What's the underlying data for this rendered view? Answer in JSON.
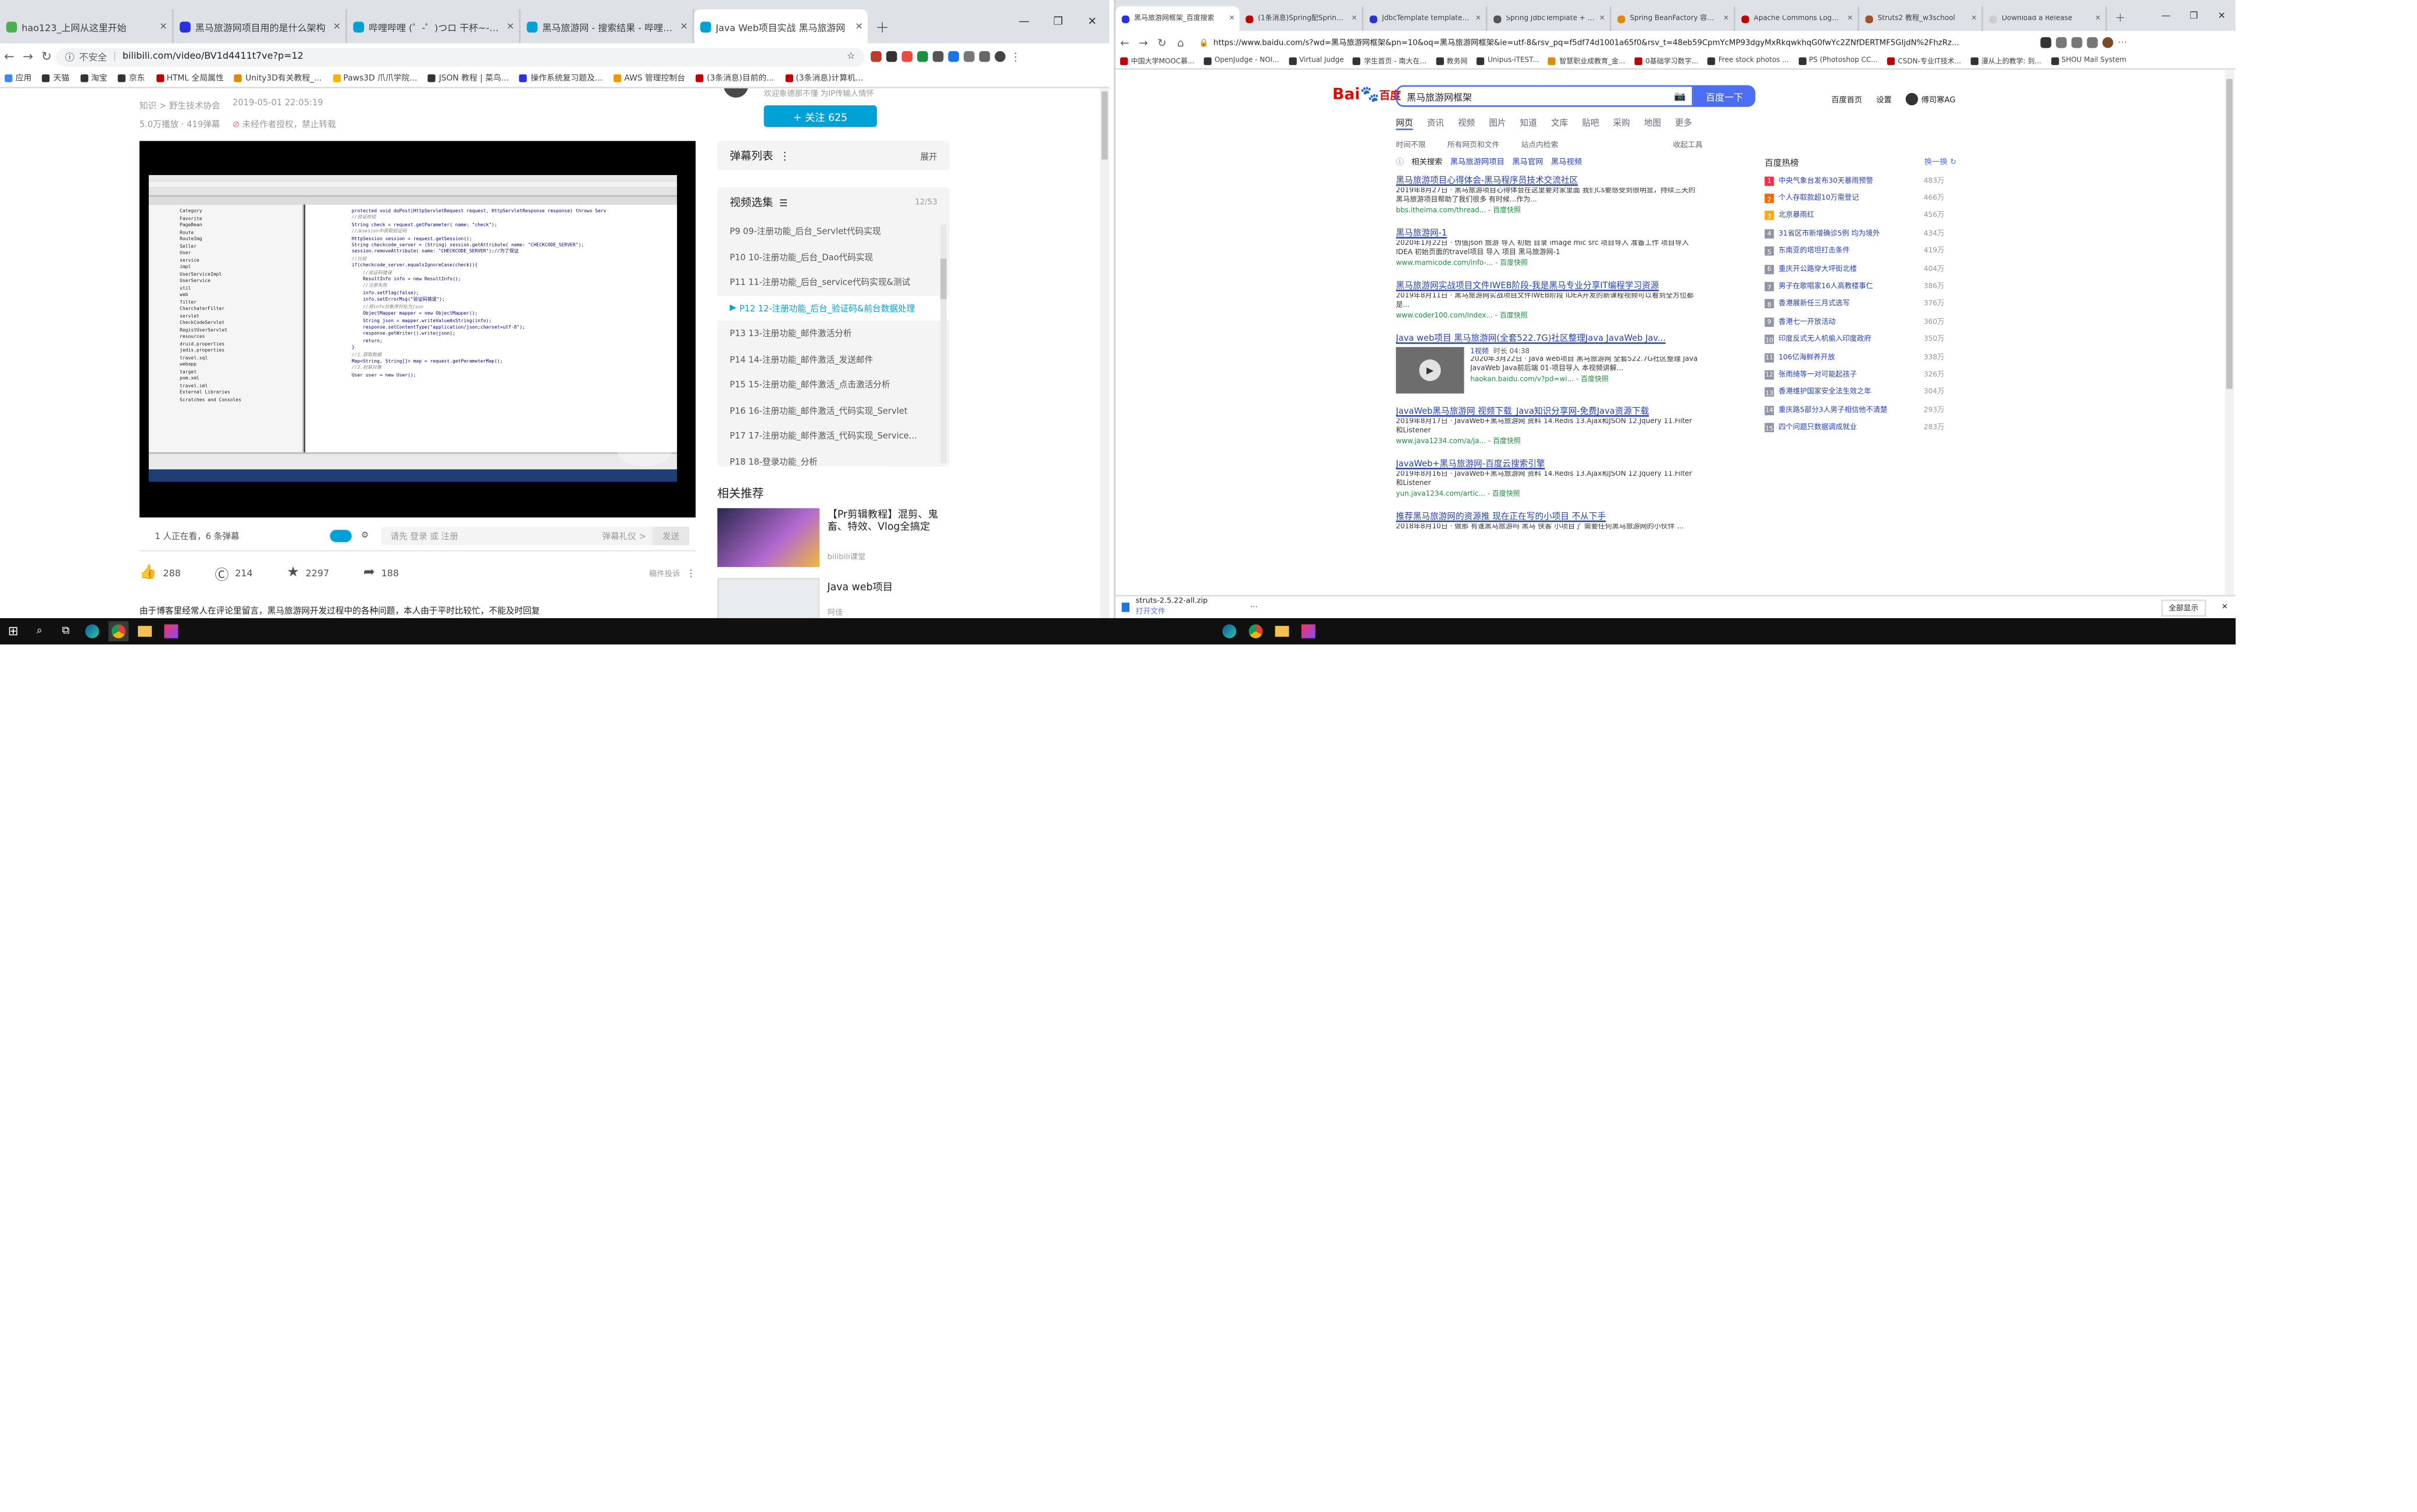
{
  "left_browser": {
    "tabs": [
      {
        "title": "hao123_上网从这里开始",
        "icon_color": "#4caf50"
      },
      {
        "title": "黑马旅游网项目用的是什么架构",
        "icon_color": "#2932e1"
      },
      {
        "title": "哔哩哔哩 (゜-゜)つロ 干杯~-bili",
        "icon_color": "#00a1d6"
      },
      {
        "title": "黑马旅游网 - 搜索结果 - 哔哩哔哩",
        "icon_color": "#00a1d6"
      },
      {
        "title": "Java Web项目实战 黑马旅游网",
        "icon_color": "#00a1d6"
      }
    ],
    "url_security": "不安全",
    "url": "bilibili.com/video/BV1d4411t7ve?p=12",
    "bookmarks": [
      {
        "label": "应用",
        "color": "#4285f4"
      },
      {
        "label": "天猫",
        "color": "#333333"
      },
      {
        "label": "淘宝",
        "color": "#333333"
      },
      {
        "label": "京东",
        "color": "#333333"
      },
      {
        "label": "HTML 全局属性",
        "color": "#c00000"
      },
      {
        "label": "Unity3D有关教程_...",
        "color": "#e08a00"
      },
      {
        "label": "Paws3D 爪爪学院...",
        "color": "#f4b400"
      },
      {
        "label": "JSON 教程 | 菜鸟...",
        "color": "#333333"
      },
      {
        "label": "操作系统复习题及...",
        "color": "#2932e1"
      },
      {
        "label": "AWS 管理控制台",
        "color": "#f79400"
      },
      {
        "label": "(3条消息)目前的...",
        "color": "#c00000"
      },
      {
        "label": "(3条消息)计算机...",
        "color": "#c00000"
      }
    ],
    "page": {
      "breadcrumb": "知识 > 野生技术协会",
      "date": "2019-05-01 22:05:19",
      "views": "5.0万播放 · 419弹幕",
      "warning": "未经作者授权，禁止转载",
      "uploader_desc": "欢迎象德那不懂 为IP传输人情怀",
      "follow_label": "+ 关注 625",
      "danmaku_list": "弹幕列表",
      "danmaku_expand": "展开",
      "playlist_title": "视频选集",
      "playlist_count": "12/53",
      "playlist": [
        {
          "label": "P9  09-注册功能_后台_Servlet代码实现",
          "active": false
        },
        {
          "label": "P10  10-注册功能_后台_Dao代码实现",
          "active": false
        },
        {
          "label": "P11  11-注册功能_后台_service代码实现&测试",
          "active": false
        },
        {
          "label": "P12  12-注册功能_后台_验证码&前台数据处理",
          "active": true
        },
        {
          "label": "P13  13-注册功能_邮件激活分析",
          "active": false
        },
        {
          "label": "P14  14-注册功能_邮件激活_发送邮件",
          "active": false
        },
        {
          "label": "P15  15-注册功能_邮件激活_点击激活分析",
          "active": false
        },
        {
          "label": "P16  16-注册功能_邮件激活_代码实现_Servlet",
          "active": false
        },
        {
          "label": "P17  17-注册功能_邮件激活_代码实现_Service...",
          "active": false
        },
        {
          "label": "P18  18-登录功能_分析",
          "active": false
        }
      ],
      "related_title": "相关推荐",
      "related": [
        {
          "title": "【Pr剪辑教程】混剪、鬼畜、特效、Vlog全搞定",
          "author": "bilibili课堂"
        },
        {
          "title": "Java web项目",
          "author": "阿佳"
        }
      ],
      "viewer_line": "1 人正在看，6 条弹幕",
      "danmaku_prompt": "请先 登录 或 注册",
      "danmaku_etiquette": "弹幕礼仪 >",
      "send_label": "发送",
      "likes": "288",
      "coins": "214",
      "favorites": "2297",
      "shares": "188",
      "report": "稿件投诉",
      "desc": "由于博客里经常人在评论里留言，黑马旅游网开发过程中的各种问题，本人由于平时比较忙，不能及时回复",
      "code_lines": [
        "protected void doPost(HttpServletRequest request, HttpServletResponse response) throws Serv",
        "//验证校验",
        "String check = request.getParameter( name: \"check\");",
        "//从sesion中获取验证码",
        "HttpSession session = request.getSession();",
        "String checkcode_server = (String) session.getAttribute( name: \"CHECKCODE_SERVER\");",
        "session.removeAttribute( name: \"CHECKCODE_SERVER\");//为了保证",
        "//比较",
        "if(checkcode_server.equalsIgnoreCase(check)){",
        "    //验证码错误",
        "    ResultInfo info = new ResultInfo();",
        "    //注册失败",
        "    info.setFlag(false);",
        "    info.setErrorMsg(\"验证码错误\");",
        "    //将info对象序列化为json",
        "    ObjectMapper mapper = new ObjectMapper();",
        "    String json = mapper.writeValueAsString(info);",
        "    response.setContentType(\"application/json;charset=utf-8\");",
        "    response.getWriter().write(json);",
        "    return;",
        "}",
        "",
        "//1.获取数据",
        "Map<String, String[]> map = request.getParameterMap();",
        "",
        "//2.封装对象",
        "User user = new User();"
      ],
      "tree_items": [
        "Category",
        "Favorite",
        "PageBean",
        "Route",
        "RouteImg",
        "Seller",
        "User",
        "service",
        "impl",
        "UserServiceImpl",
        "UserService",
        "util",
        "web",
        "filter",
        "CharchaterFilter",
        "servlet",
        "CheckCodeServlet",
        "RegistUserServlet",
        "resources",
        "druid.properties",
        "jedis.properties",
        "travel.sql",
        "webapp",
        "target",
        "pom.xml",
        "travel.iml",
        "External Libraries",
        "Scratches and Consoles"
      ]
    }
  },
  "right_browser": {
    "tabs": [
      {
        "title": "黑马旅游网框架_百度搜索",
        "icon_color": "#2932e1"
      },
      {
        "title": "(1条消息)Spring配Spring框...",
        "icon_color": "#c00000"
      },
      {
        "title": "JdbcTemplate template_百...",
        "icon_color": "#2932e1"
      },
      {
        "title": "Spring JdbcTemplate + bo...",
        "icon_color": "#555555"
      },
      {
        "title": "Spring BeanFactory 容器_...",
        "icon_color": "#e08a00"
      },
      {
        "title": "Apache Commons Loggin...",
        "icon_color": "#c00000"
      },
      {
        "title": "Struts2 教程_w3school",
        "icon_color": "#a0522d"
      },
      {
        "title": "Download a Release",
        "icon_color": "#cccccc"
      }
    ],
    "url": "https://www.baidu.com/s?wd=黑马旅游网框架&pn=10&oq=黑马旅游网框架&ie=utf-8&rsv_pq=f5df74d1001a65f0&rsv_t=48eb59CpmYcMP93dgyMxRkqwkhqG0fwYc2ZNfDERTMF5GIjdN%2FhzRz...",
    "bookmarks": [
      {
        "label": "中国大学MOOC慕...",
        "color": "#c00000"
      },
      {
        "label": "OpenJudge - NOI...",
        "color": "#333333"
      },
      {
        "label": "Virtual Judge",
        "color": "#333333"
      },
      {
        "label": "学生首页 - 南大在...",
        "color": "#333333"
      },
      {
        "label": "教务网",
        "color": "#333333"
      },
      {
        "label": "Unipus-iTEST...",
        "color": "#333333"
      },
      {
        "label": "智慧职业成教育_金...",
        "color": "#e08a00"
      },
      {
        "label": "0基础学习数字...",
        "color": "#c00000"
      },
      {
        "label": "Free stock photos ...",
        "color": "#333333"
      },
      {
        "label": "PS (Photoshop CC...",
        "color": "#333333"
      },
      {
        "label": "CSDN-专业IT技术...",
        "color": "#c00000"
      },
      {
        "label": "漫从上的教学: 到...",
        "color": "#333333"
      },
      {
        "label": "SHOU Mail System",
        "color": "#333333"
      }
    ],
    "search_query": "黑马旅游网框架",
    "search_button": "百度一下",
    "header_links": [
      "百度首页",
      "设置"
    ],
    "user_name": "傅司寒AG",
    "nav_tabs": [
      "网页",
      "资讯",
      "视频",
      "图片",
      "知道",
      "文库",
      "贴吧",
      "采购",
      "地图",
      "更多"
    ],
    "tools": [
      "时间不限",
      "所有网页和文件",
      "站点内检索"
    ],
    "tools_right": "收起工具",
    "related_hint": "相关搜索",
    "related_links": [
      "黑马旅游网项目",
      "黑马官网",
      "黑马视频"
    ],
    "results": [
      {
        "title": "黑马旅游项目心得体会-黑马程序员技术交流社区",
        "snippet": "2019年8月27日 · 黑马旅游项目心得体会在这里要对家里面 我们Cs要感受到很明显，持续三天的黑马旅游项目帮助了我们很多 有时候...作为...",
        "url": "bbs.itheima.com/thread...  - 百度快照"
      },
      {
        "title": "黑马旅游网-1",
        "snippet": "2020年1月22日 · 伪值json 旅游 导入 初始 目录 image mic src 项目导入 准备工作 项目导入 IDEA 初始页面的travel项目 导入 项目 黑马旅游网-1",
        "url": "www.mamicode.com/info-...  - 百度快照"
      },
      {
        "title": "黑马旅游网实战项目文件IWEB阶段-我是黑马专业分享IT编程学习资源",
        "snippet": "2019年8月11日 · 黑马旅游网实战项目文件IWEB阶段 IDEA开发的新课程视频可以看到全方位都是...",
        "url": "www.coder100.com/index...  - 百度快照"
      },
      {
        "title": "Java web项目 黑马旅游网(全套522.7G)社区整理Java JavaWeb Jav...",
        "snippet": "2020年3月22日 · Java web项目 黑马旅游网 全套522.7G社区整理 Java JavaWeb Java前后端 01-项目导入 本视频讲解...",
        "url": "haokan.baidu.com/v?pd=wi...  - 百度快照"
      },
      {
        "title": "JavaWeb黑马旅游网 视频下载_Java知识分享网-免费Java资源下载",
        "snippet": "2019年8月17日 · JavaWeb+黑马旅游网 资料 14.Redis 13.Ajax和JSON 12.Jquery 11.Filter和Listener",
        "url": "www.java1234.com/a/ja...  - 百度快照"
      },
      {
        "title": "JavaWeb+黑马旅游网-百度云搜索引擎",
        "snippet": "2019年8月16日 · JavaWeb+黑马旅游网 资料 14.Redis 13.Ajax和JSON 12.Jquery 11.Filter和Listener",
        "url": "yun.java1234.com/artic...  - 百度快照"
      },
      {
        "title": "推荐黑马旅游网的资源推 现在正在写的小项目 不从下手",
        "snippet": "2018年8月10日 · 做那 有谁黑马旅游吗 黑马 侠客 小项目了 需要任何黑马旅游网的小伙伴 ...",
        "url": ""
      }
    ],
    "video_result": {
      "length": "1视频",
      "duration": "时长 04:38"
    },
    "hot_title": "百度热榜",
    "hot_refresh": "换一换",
    "hot_list": [
      {
        "rank": "1",
        "title": "中央气象台发布30天暴雨预警",
        "count": "483万"
      },
      {
        "rank": "2",
        "title": "个人存取款超10万需登记",
        "count": "466万"
      },
      {
        "rank": "3",
        "title": "北京暴雨红",
        "count": "456万"
      },
      {
        "rank": "4",
        "title": "31省区市新增确诊5例 均为境外",
        "count": "434万"
      },
      {
        "rank": "5",
        "title": "东南亚的塔坦打击条件",
        "count": "419万"
      },
      {
        "rank": "6",
        "title": "重庆开公路穿大坪街北楼",
        "count": "404万"
      },
      {
        "rank": "7",
        "title": "男子在歌唱家16人高教楼事仁",
        "count": "386万"
      },
      {
        "rank": "8",
        "title": "香港展新任三月式选写",
        "count": "376万"
      },
      {
        "rank": "9",
        "title": "香港七一开放活动",
        "count": "360万"
      },
      {
        "rank": "10",
        "title": "印度反式无人机偷入印度政府",
        "count": "350万"
      },
      {
        "rank": "11",
        "title": "106亿海鲜养开放",
        "count": "338万"
      },
      {
        "rank": "12",
        "title": "张雨绮等一对可能起孩子",
        "count": "326万"
      },
      {
        "rank": "13",
        "title": "香港维护国家安全法生效之年",
        "count": "304万"
      },
      {
        "rank": "14",
        "title": "重庆路5部分3人男子相信他不清楚",
        "count": "293万"
      },
      {
        "rank": "15",
        "title": "四个问题只数据调成就业",
        "count": "283万"
      }
    ],
    "download_file": "struts-2.5.22-all.zip",
    "download_sub": "打开文件",
    "show_all": "全部显示"
  },
  "taskbar": {
    "right_icons": [
      "edge-icon",
      "chrome-icon",
      "explorer-icon",
      "intellij-icon"
    ]
  }
}
